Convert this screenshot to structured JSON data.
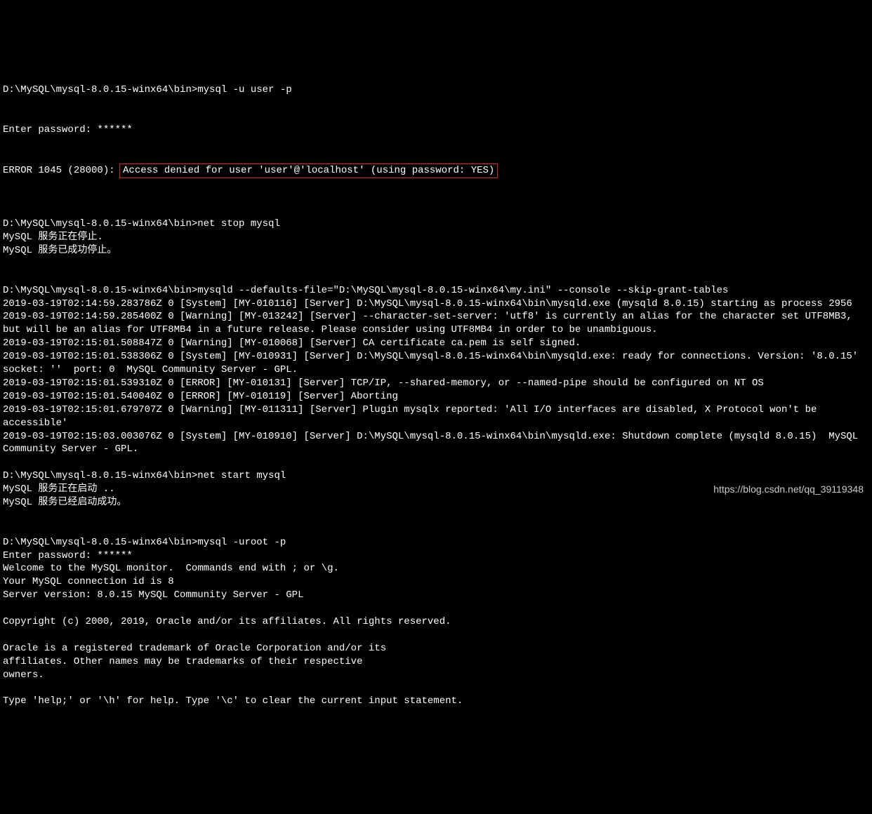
{
  "terminal": {
    "lines": [
      "D:\\MySQL\\mysql-8.0.15-winx64\\bin>mysql -u user -p",
      "Enter password: ******"
    ],
    "errorPrefix": "ERROR 1045 (28000): ",
    "errorHighlighted": "Access denied for user 'user'@'localhost' (using password: YES)",
    "block2": [
      "",
      "D:\\MySQL\\mysql-8.0.15-winx64\\bin>net stop mysql",
      "MySQL 服务正在停止.",
      "MySQL 服务已成功停止。",
      "",
      "",
      "D:\\MySQL\\mysql-8.0.15-winx64\\bin>mysqld --defaults-file=\"D:\\MySQL\\mysql-8.0.15-winx64\\my.ini\" --console --skip-grant-tables",
      "2019-03-19T02:14:59.283786Z 0 [System] [MY-010116] [Server] D:\\MySQL\\mysql-8.0.15-winx64\\bin\\mysqld.exe (mysqld 8.0.15) starting as process 2956",
      "2019-03-19T02:14:59.285400Z 0 [Warning] [MY-013242] [Server] --character-set-server: 'utf8' is currently an alias for the character set UTF8MB3, but will be an alias for UTF8MB4 in a future release. Please consider using UTF8MB4 in order to be unambiguous.",
      "2019-03-19T02:15:01.508847Z 0 [Warning] [MY-010068] [Server] CA certificate ca.pem is self signed.",
      "2019-03-19T02:15:01.538306Z 0 [System] [MY-010931] [Server] D:\\MySQL\\mysql-8.0.15-winx64\\bin\\mysqld.exe: ready for connections. Version: '8.0.15'  socket: ''  port: 0  MySQL Community Server - GPL.",
      "2019-03-19T02:15:01.539310Z 0 [ERROR] [MY-010131] [Server] TCP/IP, --shared-memory, or --named-pipe should be configured on NT OS",
      "2019-03-19T02:15:01.540040Z 0 [ERROR] [MY-010119] [Server] Aborting",
      "2019-03-19T02:15:01.679707Z 0 [Warning] [MY-011311] [Server] Plugin mysqlx reported: 'All I/O interfaces are disabled, X Protocol won't be accessible'",
      "2019-03-19T02:15:03.003076Z 0 [System] [MY-010910] [Server] D:\\MySQL\\mysql-8.0.15-winx64\\bin\\mysqld.exe: Shutdown complete (mysqld 8.0.15)  MySQL Community Server - GPL.",
      "",
      "D:\\MySQL\\mysql-8.0.15-winx64\\bin>net start mysql",
      "MySQL 服务正在启动 ..",
      "MySQL 服务已经启动成功。",
      "",
      "",
      "D:\\MySQL\\mysql-8.0.15-winx64\\bin>mysql -uroot -p",
      "Enter password: ******",
      "Welcome to the MySQL monitor.  Commands end with ; or \\g.",
      "Your MySQL connection id is 8",
      "Server version: 8.0.15 MySQL Community Server - GPL",
      "",
      "Copyright (c) 2000, 2019, Oracle and/or its affiliates. All rights reserved.",
      "",
      "Oracle is a registered trademark of Oracle Corporation and/or its",
      "affiliates. Other names may be trademarks of their respective",
      "owners.",
      "",
      "Type 'help;' or '\\h' for help. Type '\\c' to clear the current input statement."
    ]
  },
  "watermark": "https://blog.csdn.net/qq_39119348"
}
